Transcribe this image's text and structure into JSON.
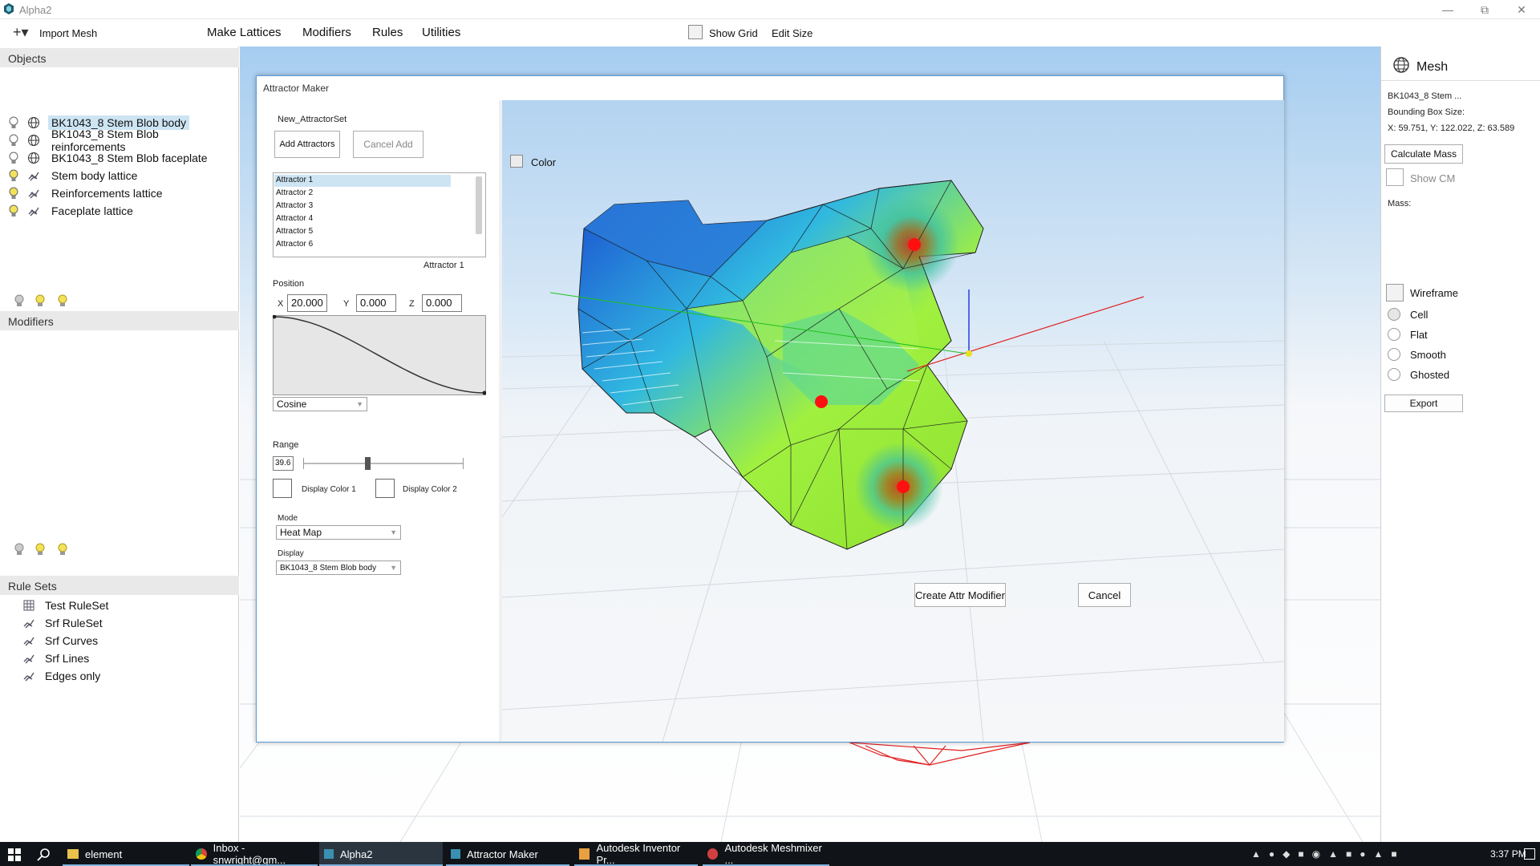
{
  "window": {
    "title": "Alpha2"
  },
  "toolbar": {
    "import_label": "Import Mesh",
    "menus": [
      "Make Lattices",
      "Modifiers",
      "Rules",
      "Utilities"
    ],
    "show_grid_label": "Show Grid",
    "edit_size_label": "Edit Size"
  },
  "objects": {
    "header": "Objects",
    "items": [
      {
        "label": "BK1043_8 Stem Blob body",
        "bulb": "off"
      },
      {
        "label": "BK1043_8 Stem Blob reinforcements",
        "bulb": "off"
      },
      {
        "label": "BK1043_8 Stem Blob faceplate",
        "bulb": "off"
      },
      {
        "label": "Stem body lattice",
        "bulb": "on"
      },
      {
        "label": "Reinforcements lattice",
        "bulb": "on"
      },
      {
        "label": "Faceplate lattice",
        "bulb": "on"
      }
    ]
  },
  "modifiers": {
    "header": "Modifiers"
  },
  "rulesets": {
    "header": "Rule Sets",
    "items": [
      "Test RuleSet",
      "Srf RuleSet",
      "Srf Curves",
      "Srf Lines",
      "Edges only"
    ]
  },
  "right_panel": {
    "title": "Mesh",
    "mesh_name": "BK1043_8 Stem ...",
    "bbox_label": "Bounding Box Size:",
    "bbox_value": "X: 59.751, Y: 122.022, Z: 63.589",
    "calc_mass": "Calculate Mass",
    "show_cm": "Show CM",
    "mass_label": "Mass:",
    "wireframe": "Wireframe",
    "radios": [
      "Cell",
      "Flat",
      "Smooth",
      "Ghosted"
    ],
    "export": "Export"
  },
  "dialog": {
    "title": "Attractor Maker",
    "set_name": "New_AttractorSet",
    "add_btn": "Add Attractors",
    "cancel_add_btn": "Cancel Add",
    "attractors": [
      "Attractor 1",
      "Attractor 2",
      "Attractor 3",
      "Attractor 4",
      "Attractor 5",
      "Attractor 6"
    ],
    "selected_attractor": "Attractor 1",
    "position_label": "Position",
    "x_label": "X",
    "x_value": "20.000",
    "y_label": "Y",
    "y_value": "0.000",
    "z_label": "Z",
    "z_value": "0.000",
    "falloff": "Cosine",
    "range_label": "Range",
    "range_value": "39.6",
    "range_fraction": 0.4,
    "display_color1": "Display Color 1",
    "display_color2": "Display Color 2",
    "mode_label": "Mode",
    "mode_value": "Heat Map",
    "display_label": "Display",
    "display_value": "BK1043_8 Stem Blob body",
    "color_label": "Color",
    "create_btn": "Create Attr Modifier",
    "cancel_btn": "Cancel"
  },
  "taskbar": {
    "items": [
      "element",
      "Inbox - snwright@gm...",
      "Alpha2",
      "Attractor Maker",
      "Autodesk Inventor Pr...",
      "Autodesk Meshmixer ..."
    ],
    "clock": "3:37 PM"
  },
  "colors": {
    "accent": "#5b9bd5",
    "selection": "#cde4f3",
    "attractor": "#ff0000",
    "axis_x": "#e02020",
    "axis_y": "#20c020",
    "axis_z": "#2040e0"
  }
}
